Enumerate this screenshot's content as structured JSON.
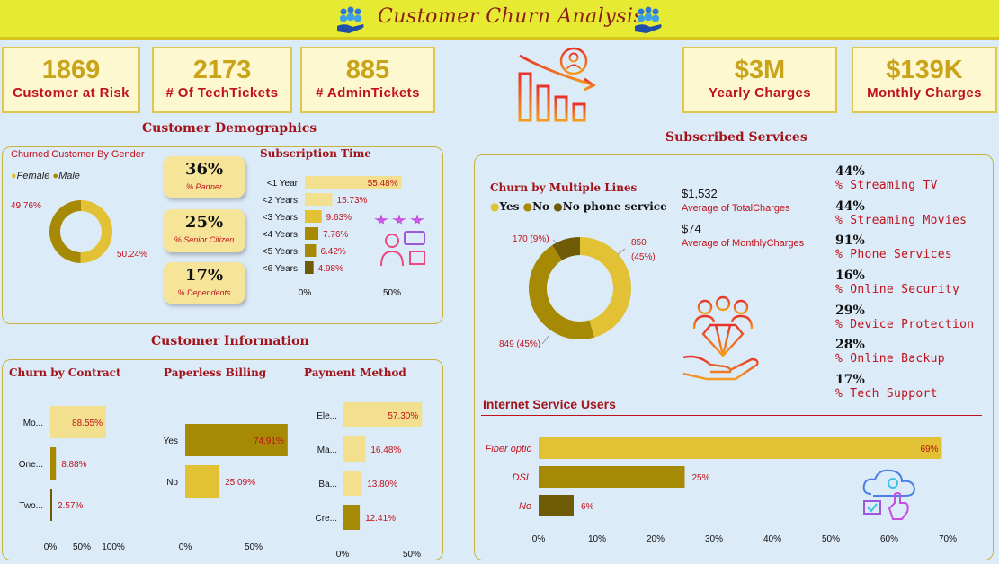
{
  "title": "Customer Churn Analysis",
  "colors": {
    "gold": "#e2c134",
    "dark_gold": "#a68a06",
    "olive": "#6f5a06",
    "pale": "#f3e08f",
    "red": "#c0121c"
  },
  "kpis": [
    {
      "value": "1869",
      "label": "Customer at Risk"
    },
    {
      "value": "2173",
      "label": "# Of TechTickets"
    },
    {
      "value": "885",
      "label": "# AdminTickets"
    },
    {
      "value": "$3M",
      "label": "Yearly Charges"
    },
    {
      "value": "$139K",
      "label": "Monthly Charges"
    }
  ],
  "sections": {
    "demographics": "Customer Demographics",
    "information": "Customer Information",
    "subscribed": "Subscribed Services"
  },
  "demographics": {
    "gender_title": "Churned Customer By Gender",
    "legend": [
      "Female",
      "Male"
    ],
    "pills": [
      {
        "value": "36%",
        "label": "% Partner"
      },
      {
        "value": "25%",
        "label": "% Senior Citizen"
      },
      {
        "value": "17%",
        "label": "% Dependents"
      }
    ],
    "subscription_title": "Subscription Time"
  },
  "information": {
    "contract_title": "Churn by Contract",
    "paperless_title": "Paperless Billing",
    "payment_title": "Payment Method"
  },
  "services": {
    "lines_title": "Churn by Multiple Lines",
    "lines_legend": [
      "Yes",
      "No",
      "No phone service"
    ],
    "total_charges_value": "$1,532",
    "total_charges_label": "Average of TotalCharges",
    "monthly_charges_value": "$74",
    "monthly_charges_label": "Average of MonthlyCharges",
    "list": [
      {
        "value": "44%",
        "label": "% Streaming TV"
      },
      {
        "value": "44%",
        "label": "% Streaming Movies"
      },
      {
        "value": "91%",
        "label": "% Phone Services"
      },
      {
        "value": "16%",
        "label": "% Online Security"
      },
      {
        "value": "29%",
        "label": "% Device Protection"
      },
      {
        "value": "28%",
        "label": "% Online Backup"
      },
      {
        "value": "17%",
        "label": "% Tech Support"
      }
    ],
    "internet_title": "Internet Service Users"
  },
  "chart_data": [
    {
      "id": "gender",
      "type": "pie",
      "title": "Churned Customer By Gender",
      "categories": [
        "Female",
        "Male"
      ],
      "values": [
        50.24,
        49.76
      ],
      "labels": [
        "50.24%",
        "49.76%"
      ]
    },
    {
      "id": "subscription",
      "type": "bar",
      "title": "Subscription Time",
      "categories": [
        "<1 Year",
        "<2 Years",
        "<3 Years",
        "<4 Years",
        "<5 Years",
        "<6 Years"
      ],
      "values": [
        55.48,
        15.73,
        9.63,
        7.76,
        6.42,
        4.98
      ],
      "labels": [
        "55.48%",
        "15.73%",
        "9.63%",
        "7.76%",
        "6.42%",
        "4.98%"
      ],
      "ticks": [
        "0%",
        "50%"
      ],
      "xlim": [
        0,
        50
      ]
    },
    {
      "id": "contract",
      "type": "bar",
      "title": "Churn by Contract",
      "categories": [
        "Mo...",
        "One...",
        "Two..."
      ],
      "values": [
        88.55,
        8.88,
        2.57
      ],
      "labels": [
        "88.55%",
        "8.88%",
        "2.57%"
      ],
      "ticks": [
        "0%",
        "50%",
        "100%"
      ],
      "xlim": [
        0,
        100
      ]
    },
    {
      "id": "paperless",
      "type": "bar",
      "title": "Paperless Billing",
      "categories": [
        "Yes",
        "No"
      ],
      "values": [
        74.91,
        25.09
      ],
      "labels": [
        "74.91%",
        "25.09%"
      ],
      "ticks": [
        "0%",
        "50%"
      ],
      "xlim": [
        0,
        50
      ]
    },
    {
      "id": "payment",
      "type": "bar",
      "title": "Payment Method",
      "categories": [
        "Ele...",
        "Ma...",
        "Ba...",
        "Cre..."
      ],
      "values": [
        57.3,
        16.48,
        13.8,
        12.41
      ],
      "labels": [
        "57.30%",
        "16.48%",
        "13.80%",
        "12.41%"
      ],
      "ticks": [
        "0%",
        "50%"
      ],
      "xlim": [
        0,
        50
      ]
    },
    {
      "id": "multiple_lines",
      "type": "pie",
      "title": "Churn by Multiple Lines",
      "categories": [
        "Yes",
        "No",
        "No phone service"
      ],
      "values": [
        850,
        849,
        170
      ],
      "labels": [
        "850 (45%)",
        "849 (45%)",
        "170 (9%)"
      ]
    },
    {
      "id": "internet",
      "type": "bar",
      "title": "Internet Service Users",
      "categories": [
        "Fiber optic",
        "DSL",
        "No"
      ],
      "values": [
        69,
        25,
        6
      ],
      "labels": [
        "69%",
        "25%",
        "6%"
      ],
      "ticks": [
        "0%",
        "10%",
        "20%",
        "30%",
        "40%",
        "50%",
        "60%",
        "70%"
      ],
      "xlim": [
        0,
        70
      ]
    }
  ]
}
